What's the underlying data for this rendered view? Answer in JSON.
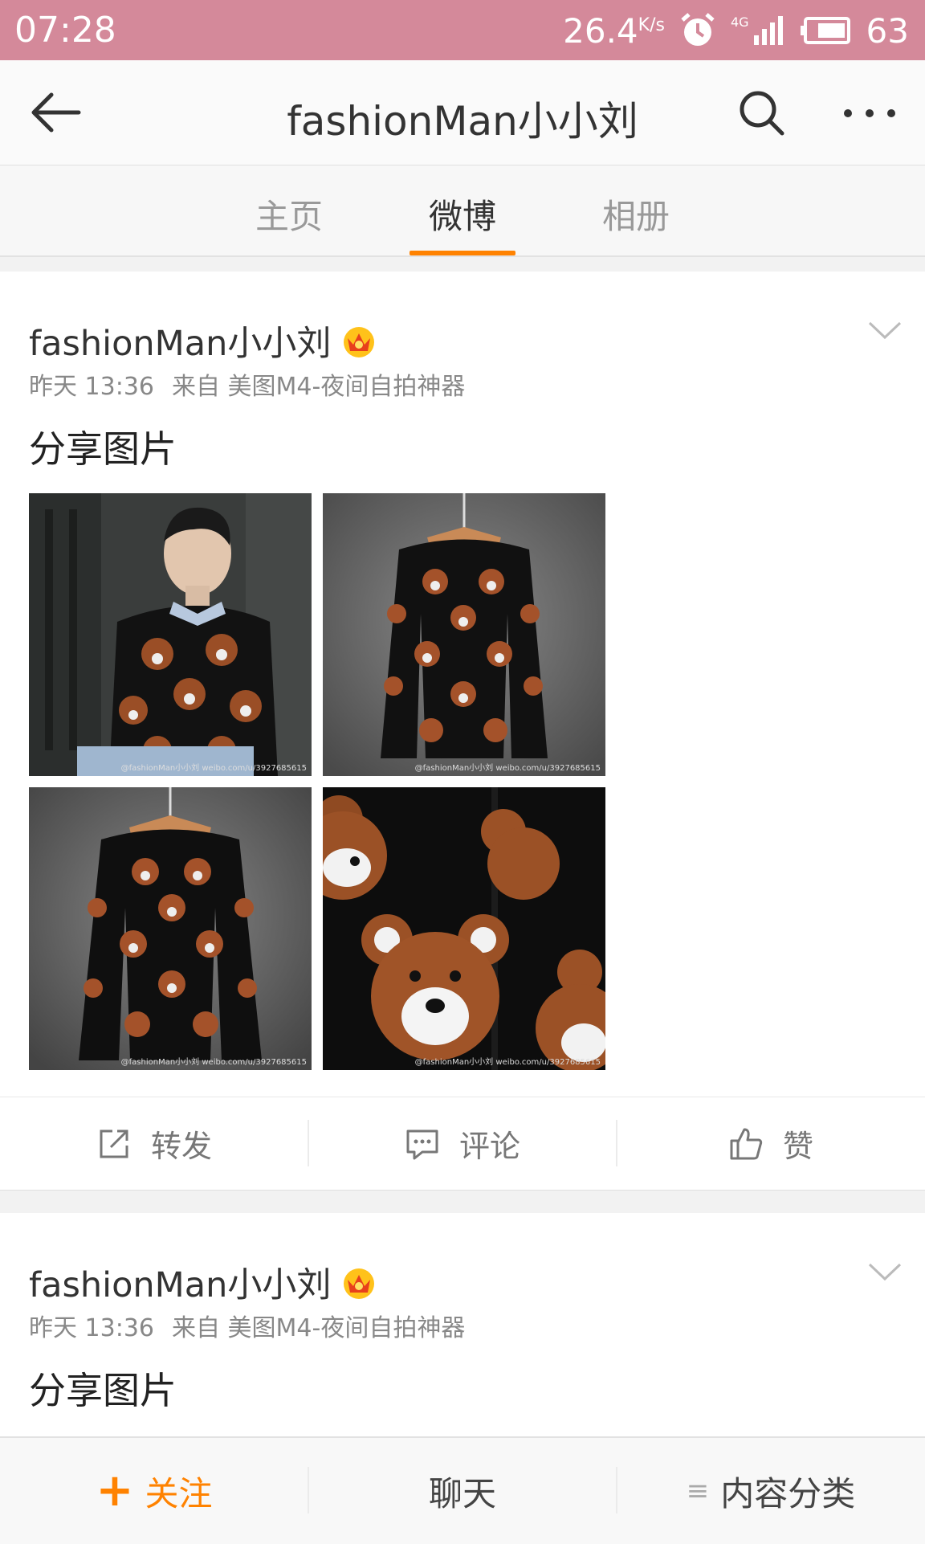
{
  "status_bar": {
    "time": "07:28",
    "speed": "26.4",
    "speed_unit": "K/s",
    "network": "4G",
    "battery": "63"
  },
  "nav": {
    "title": "fashionMan小小刘"
  },
  "tabs": [
    {
      "label": "主页"
    },
    {
      "label": "微博",
      "active": true
    },
    {
      "label": "相册"
    }
  ],
  "posts": [
    {
      "author": "fashionMan小小刘",
      "time": "昨天 13:36",
      "source": "来自 美图M4-夜间自拍神器",
      "text": "分享图片",
      "watermarks": [
        "@fashionMan小小刘 weibo.com/u/3927685615",
        "@fashionMan小小刘 weibo.com/u/3927685615",
        "@fashionMan小小刘 weibo.com/u/3927685615",
        "@fashionMan小小刘 weibo.com/u/3927685615"
      ]
    },
    {
      "author": "fashionMan小小刘",
      "time": "昨天 13:36",
      "source": "来自 美图M4-夜间自拍神器",
      "text": "分享图片"
    }
  ],
  "actions": {
    "repost": "转发",
    "comment": "评论",
    "like": "赞"
  },
  "bottom_bar": {
    "follow": "关注",
    "chat": "聊天",
    "categories": "内容分类"
  },
  "colors": {
    "status_bar_bg": "#d4899a",
    "accent": "#ff8200"
  }
}
